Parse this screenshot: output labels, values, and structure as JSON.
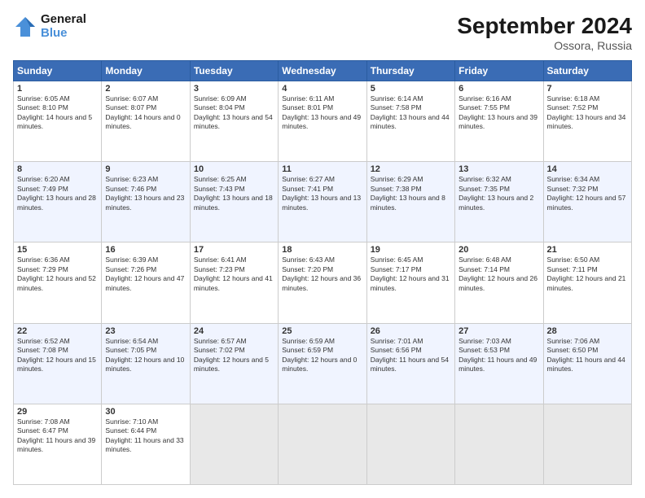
{
  "header": {
    "logo_line1": "General",
    "logo_line2": "Blue",
    "month": "September 2024",
    "location": "Ossora, Russia"
  },
  "days": [
    "Sunday",
    "Monday",
    "Tuesday",
    "Wednesday",
    "Thursday",
    "Friday",
    "Saturday"
  ],
  "weeks": [
    [
      {
        "day": "1",
        "sunrise": "6:05 AM",
        "sunset": "8:10 PM",
        "daylight": "14 hours and 5 minutes."
      },
      {
        "day": "2",
        "sunrise": "6:07 AM",
        "sunset": "8:07 PM",
        "daylight": "14 hours and 0 minutes."
      },
      {
        "day": "3",
        "sunrise": "6:09 AM",
        "sunset": "8:04 PM",
        "daylight": "13 hours and 54 minutes."
      },
      {
        "day": "4",
        "sunrise": "6:11 AM",
        "sunset": "8:01 PM",
        "daylight": "13 hours and 49 minutes."
      },
      {
        "day": "5",
        "sunrise": "6:14 AM",
        "sunset": "7:58 PM",
        "daylight": "13 hours and 44 minutes."
      },
      {
        "day": "6",
        "sunrise": "6:16 AM",
        "sunset": "7:55 PM",
        "daylight": "13 hours and 39 minutes."
      },
      {
        "day": "7",
        "sunrise": "6:18 AM",
        "sunset": "7:52 PM",
        "daylight": "13 hours and 34 minutes."
      }
    ],
    [
      {
        "day": "8",
        "sunrise": "6:20 AM",
        "sunset": "7:49 PM",
        "daylight": "13 hours and 28 minutes."
      },
      {
        "day": "9",
        "sunrise": "6:23 AM",
        "sunset": "7:46 PM",
        "daylight": "13 hours and 23 minutes."
      },
      {
        "day": "10",
        "sunrise": "6:25 AM",
        "sunset": "7:43 PM",
        "daylight": "13 hours and 18 minutes."
      },
      {
        "day": "11",
        "sunrise": "6:27 AM",
        "sunset": "7:41 PM",
        "daylight": "13 hours and 13 minutes."
      },
      {
        "day": "12",
        "sunrise": "6:29 AM",
        "sunset": "7:38 PM",
        "daylight": "13 hours and 8 minutes."
      },
      {
        "day": "13",
        "sunrise": "6:32 AM",
        "sunset": "7:35 PM",
        "daylight": "13 hours and 2 minutes."
      },
      {
        "day": "14",
        "sunrise": "6:34 AM",
        "sunset": "7:32 PM",
        "daylight": "12 hours and 57 minutes."
      }
    ],
    [
      {
        "day": "15",
        "sunrise": "6:36 AM",
        "sunset": "7:29 PM",
        "daylight": "12 hours and 52 minutes."
      },
      {
        "day": "16",
        "sunrise": "6:39 AM",
        "sunset": "7:26 PM",
        "daylight": "12 hours and 47 minutes."
      },
      {
        "day": "17",
        "sunrise": "6:41 AM",
        "sunset": "7:23 PM",
        "daylight": "12 hours and 41 minutes."
      },
      {
        "day": "18",
        "sunrise": "6:43 AM",
        "sunset": "7:20 PM",
        "daylight": "12 hours and 36 minutes."
      },
      {
        "day": "19",
        "sunrise": "6:45 AM",
        "sunset": "7:17 PM",
        "daylight": "12 hours and 31 minutes."
      },
      {
        "day": "20",
        "sunrise": "6:48 AM",
        "sunset": "7:14 PM",
        "daylight": "12 hours and 26 minutes."
      },
      {
        "day": "21",
        "sunrise": "6:50 AM",
        "sunset": "7:11 PM",
        "daylight": "12 hours and 21 minutes."
      }
    ],
    [
      {
        "day": "22",
        "sunrise": "6:52 AM",
        "sunset": "7:08 PM",
        "daylight": "12 hours and 15 minutes."
      },
      {
        "day": "23",
        "sunrise": "6:54 AM",
        "sunset": "7:05 PM",
        "daylight": "12 hours and 10 minutes."
      },
      {
        "day": "24",
        "sunrise": "6:57 AM",
        "sunset": "7:02 PM",
        "daylight": "12 hours and 5 minutes."
      },
      {
        "day": "25",
        "sunrise": "6:59 AM",
        "sunset": "6:59 PM",
        "daylight": "12 hours and 0 minutes."
      },
      {
        "day": "26",
        "sunrise": "7:01 AM",
        "sunset": "6:56 PM",
        "daylight": "11 hours and 54 minutes."
      },
      {
        "day": "27",
        "sunrise": "7:03 AM",
        "sunset": "6:53 PM",
        "daylight": "11 hours and 49 minutes."
      },
      {
        "day": "28",
        "sunrise": "7:06 AM",
        "sunset": "6:50 PM",
        "daylight": "11 hours and 44 minutes."
      }
    ],
    [
      {
        "day": "29",
        "sunrise": "7:08 AM",
        "sunset": "6:47 PM",
        "daylight": "11 hours and 39 minutes."
      },
      {
        "day": "30",
        "sunrise": "7:10 AM",
        "sunset": "6:44 PM",
        "daylight": "11 hours and 33 minutes."
      },
      null,
      null,
      null,
      null,
      null
    ]
  ]
}
